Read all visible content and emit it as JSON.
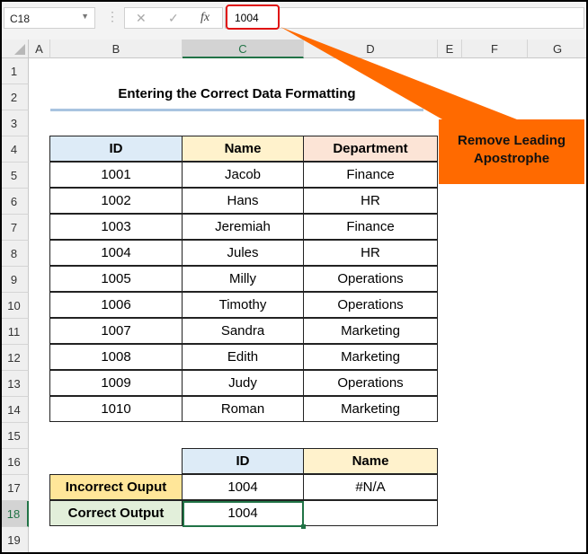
{
  "formula_bar": {
    "name_box": "C18",
    "cancel": "✕",
    "enter": "✓",
    "fx": "fx",
    "value": "1004"
  },
  "columns": [
    "A",
    "B",
    "C",
    "D",
    "E",
    "F",
    "G"
  ],
  "rows": [
    "1",
    "2",
    "3",
    "4",
    "5",
    "6",
    "7",
    "8",
    "9",
    "10",
    "11",
    "12",
    "13",
    "14",
    "15",
    "16",
    "17",
    "18",
    "19"
  ],
  "title": "Entering the Correct Data Formatting",
  "callout": "Remove Leading Apostrophe",
  "table": {
    "headers": [
      "ID",
      "Name",
      "Department"
    ],
    "rows": [
      [
        "1001",
        "Jacob",
        "Finance"
      ],
      [
        "1002",
        "Hans",
        "HR"
      ],
      [
        "1003",
        "Jeremiah",
        "Finance"
      ],
      [
        "1004",
        "Jules",
        "HR"
      ],
      [
        "1005",
        "Milly",
        "Operations"
      ],
      [
        "1006",
        "Timothy",
        "Operations"
      ],
      [
        "1007",
        "Sandra",
        "Marketing"
      ],
      [
        "1008",
        "Edith",
        "Marketing"
      ],
      [
        "1009",
        "Judy",
        "Operations"
      ],
      [
        "1010",
        "Roman",
        "Marketing"
      ]
    ]
  },
  "output": {
    "headers": [
      "ID",
      "Name"
    ],
    "rows": [
      {
        "label": "Incorrect Ouput",
        "id": "1004",
        "name": "#N/A"
      },
      {
        "label": "Correct Output",
        "id": "1004",
        "name": ""
      }
    ]
  },
  "colors": {
    "accent": "#217346",
    "callout": "#ff6a00",
    "highlight": "#e01010"
  }
}
